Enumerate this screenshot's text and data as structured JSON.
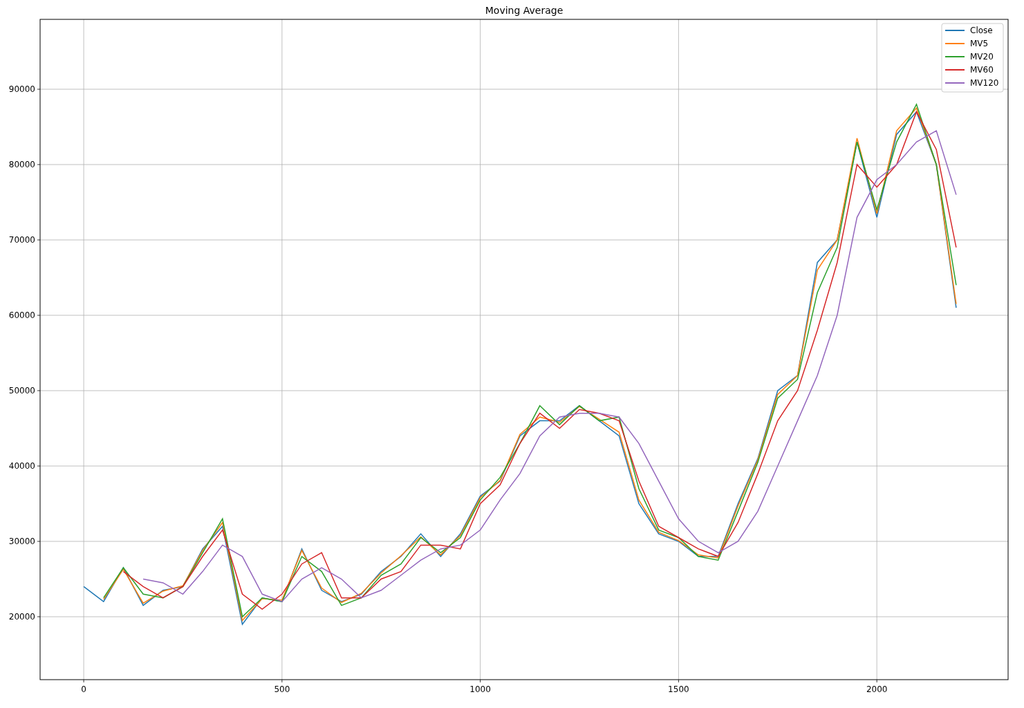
{
  "figure": {
    "chart_data": {
      "type": "line",
      "title": "Moving Average",
      "x": [
        0,
        50,
        100,
        150,
        200,
        250,
        300,
        350,
        400,
        450,
        500,
        550,
        600,
        650,
        700,
        750,
        800,
        850,
        900,
        950,
        1000,
        1050,
        1100,
        1150,
        1200,
        1250,
        1300,
        1350,
        1400,
        1450,
        1500,
        1550,
        1600,
        1650,
        1700,
        1750,
        1800,
        1850,
        1900,
        1950,
        2000,
        2050,
        2100,
        2150,
        2200
      ],
      "series": [
        {
          "name": "Close",
          "color": "#1f77b4",
          "values": [
            24000,
            22000,
            26500,
            21500,
            23500,
            24000,
            29000,
            32000,
            19000,
            22500,
            22000,
            29000,
            23500,
            22000,
            23000,
            26000,
            28000,
            31000,
            28000,
            31000,
            36000,
            38000,
            44000,
            46000,
            46000,
            48000,
            46000,
            44000,
            35000,
            31000,
            30000,
            28000,
            28000,
            35000,
            41000,
            50000,
            52000,
            67000,
            70000,
            83000,
            73000,
            84000,
            87000,
            80000,
            61000
          ]
        },
        {
          "name": "MV5",
          "color": "#ff7f0e",
          "values": [
            null,
            22300,
            26300,
            21800,
            23400,
            24100,
            28800,
            32500,
            19500,
            22400,
            22200,
            28800,
            23800,
            21900,
            23100,
            25800,
            28100,
            30600,
            28200,
            30800,
            35800,
            38100,
            44200,
            46500,
            45800,
            47900,
            46200,
            44500,
            35500,
            31200,
            30100,
            28200,
            27800,
            34700,
            40800,
            49500,
            52000,
            66000,
            70000,
            83500,
            73500,
            84500,
            87500,
            80000,
            61500
          ]
        },
        {
          "name": "MV20",
          "color": "#2ca02c",
          "values": [
            null,
            22500,
            26500,
            23000,
            22500,
            24000,
            28500,
            33000,
            20000,
            22500,
            22000,
            28000,
            26000,
            21500,
            22500,
            25500,
            27000,
            30500,
            28500,
            30500,
            35500,
            38500,
            43000,
            48000,
            45500,
            48000,
            46000,
            46500,
            37000,
            31500,
            30500,
            28000,
            27500,
            34000,
            40500,
            49000,
            51500,
            63000,
            69000,
            83000,
            74000,
            83000,
            88000,
            80000,
            64000
          ]
        },
        {
          "name": "MV60",
          "color": "#d62728",
          "values": [
            null,
            null,
            26000,
            24000,
            22500,
            24000,
            28000,
            31500,
            23000,
            21000,
            23000,
            27000,
            28500,
            22500,
            22500,
            25000,
            26000,
            29500,
            29500,
            29000,
            35000,
            37500,
            43000,
            47000,
            45000,
            47500,
            47000,
            46000,
            38000,
            32000,
            30500,
            29000,
            28000,
            32500,
            39000,
            46000,
            50000,
            58000,
            67000,
            80000,
            77000,
            80000,
            87000,
            82000,
            69000
          ]
        },
        {
          "name": "MV120",
          "color": "#9467bd",
          "values": [
            null,
            null,
            null,
            25000,
            24500,
            23000,
            26000,
            29500,
            28000,
            23000,
            22000,
            25000,
            26500,
            25000,
            22500,
            23500,
            25500,
            27500,
            29000,
            29500,
            31500,
            35500,
            39000,
            44000,
            46500,
            47000,
            47000,
            46500,
            43000,
            38000,
            33000,
            30000,
            28500,
            30000,
            34000,
            40000,
            46000,
            52000,
            60000,
            73000,
            78000,
            80000,
            83000,
            84500,
            76000
          ]
        }
      ],
      "xlim": [
        -110,
        2331
      ],
      "ylim": [
        11650,
        99270
      ],
      "xticks": [
        0,
        500,
        1000,
        1500,
        2000
      ],
      "yticks": [
        20000,
        30000,
        40000,
        50000,
        60000,
        70000,
        80000,
        90000
      ],
      "grid": true,
      "legend": "upper right"
    }
  }
}
